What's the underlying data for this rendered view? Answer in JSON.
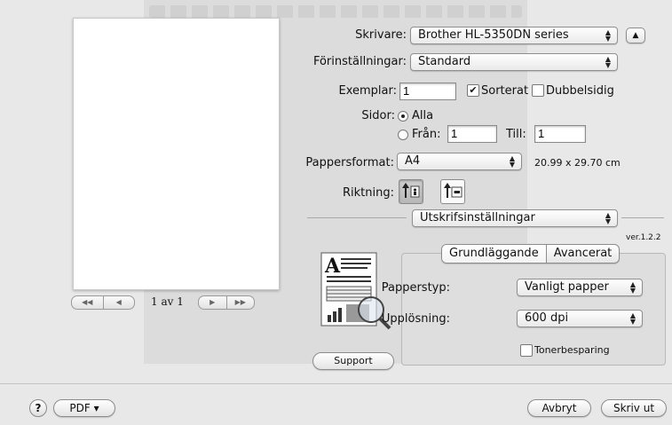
{
  "printer": {
    "label": "Skrivare:",
    "value": "Brother HL-5350DN series"
  },
  "presets": {
    "label": "Förinställningar:",
    "value": "Standard"
  },
  "copies": {
    "label": "Exemplar:",
    "value": "1",
    "collated_label": "Sorterat",
    "collated_checked": true,
    "duplex_label": "Dubbelsidig",
    "duplex_checked": false
  },
  "pages": {
    "label": "Sidor:",
    "all_label": "Alla",
    "from_label": "Från:",
    "from_value": "1",
    "to_label": "Till:",
    "to_value": "1"
  },
  "paper": {
    "label": "Pappersformat:",
    "value": "A4",
    "dimensions": "20.99 x 29.70 cm"
  },
  "orientation": {
    "label": "Riktning:"
  },
  "section": {
    "value": "Utskrifsinställningar"
  },
  "version": "ver.1.2.2",
  "tabs": [
    {
      "label": "Grundläggande"
    },
    {
      "label": "Avancerat"
    }
  ],
  "media": {
    "label": "Papperstyp:",
    "value": "Vanligt papper"
  },
  "resolution": {
    "label": "Upplösning:",
    "value": "600 dpi"
  },
  "toner": {
    "label": "Tonerbesparing",
    "checked": false
  },
  "support_label": "Support",
  "preview": {
    "page_indicator": "1 av 1"
  },
  "footer": {
    "help": "?",
    "pdf_label": "PDF ▾",
    "cancel_label": "Avbryt",
    "print_label": "Skriv ut"
  }
}
